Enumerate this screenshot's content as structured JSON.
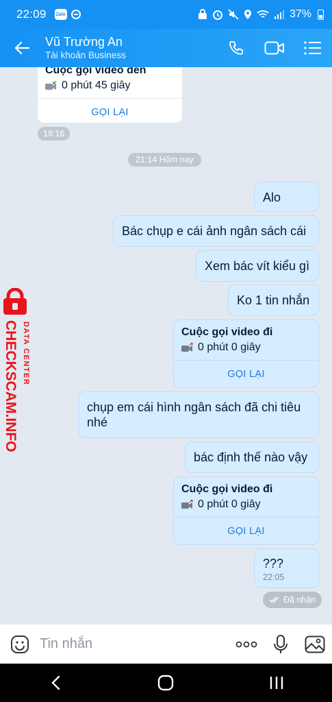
{
  "status_bar": {
    "time": "22:09",
    "zalo_badge": "Zalo",
    "battery": "37%"
  },
  "header": {
    "name": "Vũ Trường An",
    "subtitle": "Tài khoản Business"
  },
  "messages": {
    "incoming_call": {
      "title": "Cuộc gọi video đến",
      "duration": "0 phút 45 giây",
      "action": "GỌI LẠI",
      "time": "19:16"
    },
    "date_separator": "21:14 Hôm nay",
    "m1": "Alo",
    "m2": "Bác chụp e cái ảnh ngân sách cái",
    "m3": "Xem bác vít kiểu gì",
    "m4": "Ko 1 tin nhắn",
    "call1": {
      "title": "Cuộc gọi video đi",
      "duration": "0 phút 0 giây",
      "action": "GỌI LẠI"
    },
    "m5": "chụp em cái hình ngân sách đã chi tiêu nhé",
    "m6": "bác định thế nào vậy",
    "call2": {
      "title": "Cuộc gọi video đi",
      "duration": "0 phút 0 giây",
      "action": "GỌI LẠI"
    },
    "m7": "???",
    "m7_time": "22:05",
    "status": "Đã nhận"
  },
  "watermark": {
    "line1": "CHECKSCAM.INFO",
    "line2": "DATA CENTER"
  },
  "composer": {
    "placeholder": "Tin nhắn"
  },
  "colors": {
    "header": "#1591f4",
    "outgoing_bubble": "#d6ecff",
    "chat_bg": "#e2e9f1",
    "watermark": "#e8141b"
  }
}
